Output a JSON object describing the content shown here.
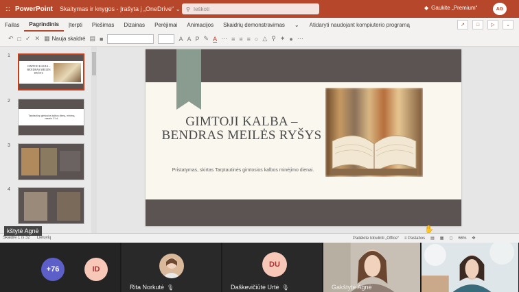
{
  "app": {
    "waffle": ":::",
    "name": "PowerPoint",
    "doc_title": "Skaitymas ir knygos - Įrašyta į „OneDrive“ ⌄",
    "search_placeholder": "Ieškoti",
    "premium": "Gaukite „Premium“",
    "avatar": "AG",
    "brand_color": "#b7472a"
  },
  "tabs": {
    "items": [
      "Failas",
      "Pagrindinis",
      "Įterpti",
      "Piešimas",
      "Dizainas",
      "Perėjimai",
      "Animacijos",
      "Skaidrių demonstravimas",
      "⌄"
    ],
    "active": "Pagrindinis",
    "extra": "Atidaryti naudojant kompiuterio programą"
  },
  "toolbar": {
    "new_slide": "Nauja skaidrė"
  },
  "thumbnails": [
    {
      "num": "1",
      "title": "GIMTOJI KALBA – BENDRAS MEILĖS RYŠYS"
    },
    {
      "num": "2",
      "text": "Tarptautinę gimtosios kalbos dieną, minimą vasario 21 d."
    },
    {
      "num": "3"
    },
    {
      "num": "4"
    }
  ],
  "slide": {
    "title": "GIMTOJI KALBA – BENDRAS MEILĖS RYŠYS",
    "subtitle": "Pristatymas, skirtas Tarptautinės gimtosios kalbos minėjimo dienai."
  },
  "statusbar": {
    "slide_info": "Skaidrė 1 iš 32",
    "language": "Lietuvių",
    "help": "Padėkite tobulinti „Office“",
    "notes": "≡ Pastabos",
    "zoom": "66%"
  },
  "presenter_overlay": "kštytė Agnė",
  "participants": [
    {
      "label": "+76",
      "color": "#5b5fc7"
    },
    {
      "label": "ID",
      "color": "#f7c7b8"
    },
    {
      "name": "Rita Norkutė"
    },
    {
      "label": "DU",
      "name": "Daškevičiūtė Urtė",
      "color": "#f7c7b8"
    },
    {
      "name": "Gakštytė Agnė"
    },
    {
      "name": ""
    }
  ]
}
